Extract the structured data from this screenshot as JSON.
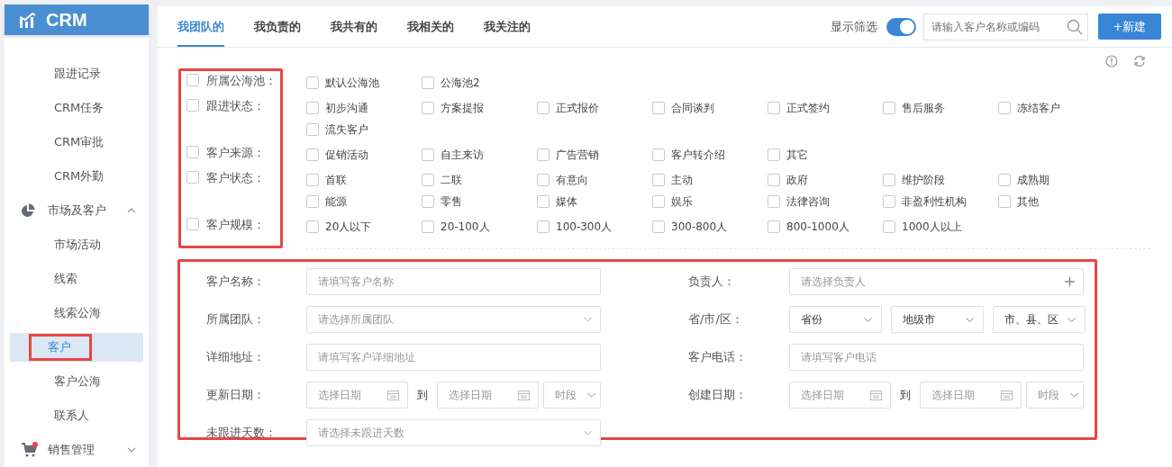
{
  "sidebar": {
    "brand": "CRM",
    "items": [
      {
        "kind": "link",
        "label": "跟进记录",
        "selected": false
      },
      {
        "kind": "link",
        "label": "CRM任务",
        "selected": false
      },
      {
        "kind": "link",
        "label": "CRM审批",
        "selected": false
      },
      {
        "kind": "link",
        "label": "CRM外勤",
        "selected": false
      },
      {
        "kind": "group",
        "label": "市场及客户",
        "expanded": true,
        "children": [
          {
            "label": "市场活动",
            "selected": false
          },
          {
            "label": "线索",
            "selected": false
          },
          {
            "label": "线索公海",
            "selected": false
          },
          {
            "label": "客户",
            "selected": true
          },
          {
            "label": "客户公海",
            "selected": false
          },
          {
            "label": "联系人",
            "selected": false
          }
        ]
      },
      {
        "kind": "group",
        "label": "销售管理",
        "expanded": false,
        "notification": true
      }
    ]
  },
  "tabs": [
    {
      "label": "我团队的",
      "selected": true
    },
    {
      "label": "我负责的",
      "selected": false
    },
    {
      "label": "我共有的",
      "selected": false
    },
    {
      "label": "我相关的",
      "selected": false
    },
    {
      "label": "我关注的",
      "selected": false
    }
  ],
  "toolbar": {
    "filter_toggle": {
      "label": "显示筛选",
      "on": true
    },
    "search": {
      "placeholder": "请输入客户名称或编码"
    },
    "new_button": "+新建"
  },
  "filters": [
    {
      "label": "所属公海池：",
      "checked": false,
      "options": [
        {
          "label": "默认公海池",
          "checked": false
        },
        {
          "label": "公海池2",
          "checked": false
        }
      ]
    },
    {
      "label": "跟进状态：",
      "checked": false,
      "options": [
        {
          "label": "初步沟通",
          "checked": false
        },
        {
          "label": "方案提报",
          "checked": false
        },
        {
          "label": "正式报价",
          "checked": false
        },
        {
          "label": "合同谈判",
          "checked": false
        },
        {
          "label": "正式签约",
          "checked": false
        },
        {
          "label": "售后服务",
          "checked": false
        },
        {
          "label": "冻结客户",
          "checked": false
        },
        {
          "label": "流失客户",
          "checked": false
        }
      ]
    },
    {
      "label": "客户来源：",
      "checked": false,
      "options": [
        {
          "label": "促销活动",
          "checked": false
        },
        {
          "label": "自主来访",
          "checked": false
        },
        {
          "label": "广告营销",
          "checked": false
        },
        {
          "label": "客户转介绍",
          "checked": false
        },
        {
          "label": "其它",
          "checked": false
        }
      ]
    },
    {
      "label": "客户状态：",
      "checked": false,
      "options": [
        {
          "label": "首联",
          "checked": false
        },
        {
          "label": "二联",
          "checked": false
        },
        {
          "label": "有意向",
          "checked": false
        },
        {
          "label": "主动",
          "checked": false
        },
        {
          "label": "政府",
          "checked": false
        },
        {
          "label": "维护阶段",
          "checked": false
        },
        {
          "label": "成熟期",
          "checked": false
        },
        {
          "label": "能源",
          "checked": false
        },
        {
          "label": "零售",
          "checked": false
        },
        {
          "label": "媒体",
          "checked": false
        },
        {
          "label": "娱乐",
          "checked": false
        },
        {
          "label": "法律咨询",
          "checked": false
        },
        {
          "label": "非盈利性机构",
          "checked": false
        },
        {
          "label": "其他",
          "checked": false
        }
      ]
    },
    {
      "label": "客户规模：",
      "checked": false,
      "options": [
        {
          "label": "20人以下",
          "checked": false
        },
        {
          "label": "20-100人",
          "checked": false
        },
        {
          "label": "100-300人",
          "checked": false
        },
        {
          "label": "300-800人",
          "checked": false
        },
        {
          "label": "800-1000人",
          "checked": false
        },
        {
          "label": "1000人以上",
          "checked": false
        }
      ]
    }
  ],
  "form": {
    "rows": [
      [
        {
          "kind": "input",
          "label": "客户名称：",
          "placeholder": "请填写客户名称"
        },
        {
          "kind": "picker",
          "label": "负责人：",
          "placeholder": "请选择负责人"
        }
      ],
      [
        {
          "kind": "select",
          "label": "所属团队：",
          "placeholder": "请选择所属团队"
        },
        {
          "kind": "region",
          "label": "省/市/区：",
          "selects": [
            {
              "value": "省份"
            },
            {
              "value": "地级市"
            },
            {
              "value": "市、县、区"
            }
          ]
        }
      ],
      [
        {
          "kind": "input",
          "label": "详细地址：",
          "placeholder": "请填写客户详细地址"
        },
        {
          "kind": "input",
          "label": "客户电话：",
          "placeholder": "请填写客户电话"
        }
      ],
      [
        {
          "kind": "daterange",
          "label": "更新日期：",
          "start_placeholder": "选择日期",
          "separator": "到",
          "end_placeholder": "选择日期",
          "period_placeholder": "时段"
        },
        {
          "kind": "daterange",
          "label": "创建日期：",
          "start_placeholder": "选择日期",
          "separator": "到",
          "end_placeholder": "选择日期",
          "period_placeholder": "时段"
        }
      ],
      [
        {
          "kind": "select",
          "label": "未跟进天数：",
          "placeholder": "请选择未跟进天数"
        }
      ]
    ]
  }
}
